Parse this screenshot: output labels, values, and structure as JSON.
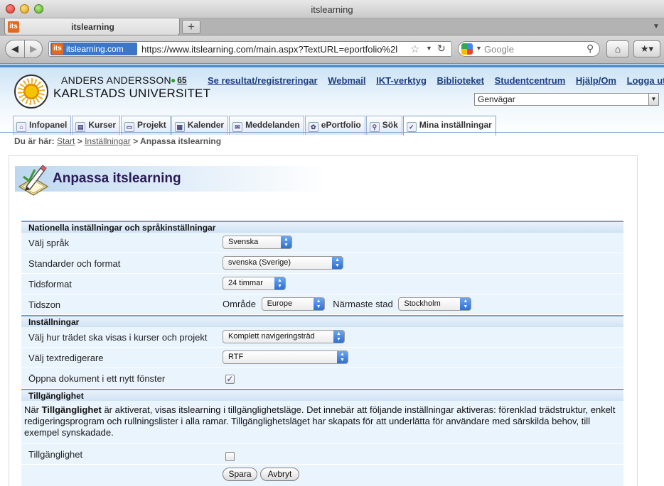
{
  "browser": {
    "window_title": "itslearning",
    "tab_label": "itslearning",
    "favicon_text": "its",
    "site_identity": "itslearning.com",
    "url": "https://www.itslearning.com/main.aspx?TextURL=eportfolio%2l",
    "search_placeholder": "Google"
  },
  "header": {
    "user_name": "ANDERS ANDERSSON",
    "online_count": "65",
    "university": "KARLSTADS UNIVERSITET",
    "links": [
      "Se resultat/registreringar",
      "Webmail",
      "IKT-verktyg",
      "Biblioteket",
      "Studentcentrum",
      "Hjälp/Om",
      "Logga ut"
    ],
    "shortcut_select": "Genvägar"
  },
  "mainnav": {
    "tabs": [
      {
        "label": "Infopanel",
        "icon": "home-icon"
      },
      {
        "label": "Kurser",
        "icon": "courses-icon"
      },
      {
        "label": "Projekt",
        "icon": "project-icon"
      },
      {
        "label": "Kalender",
        "icon": "calendar-icon"
      },
      {
        "label": "Meddelanden",
        "icon": "mail-icon"
      },
      {
        "label": "ePortfolio",
        "icon": "eportfolio-icon"
      },
      {
        "label": "Sök",
        "icon": "search-icon"
      },
      {
        "label": "Mina inställningar",
        "icon": "settings-icon",
        "active": true
      }
    ]
  },
  "breadcrumb": {
    "prefix": "Du är här:",
    "start": "Start",
    "sep": ">",
    "settings": "Inställningar",
    "current": "Anpassa itslearning"
  },
  "page": {
    "title": "Anpassa itslearning"
  },
  "sections": {
    "national": {
      "heading": "Nationella inställningar och språkinställningar",
      "language_label": "Välj språk",
      "language_value": "Svenska",
      "format_label": "Standarder och format",
      "format_value": "svenska (Sverige)",
      "time_label": "Tidsformat",
      "time_value": "24 timmar",
      "zone_label": "Tidszon",
      "area_label": "Område",
      "area_value": "Europe",
      "city_label": "Närmaste stad",
      "city_value": "Stockholm"
    },
    "settings": {
      "heading": "Inställningar",
      "tree_label": "Välj hur trädet ska visas i kurser och projekt",
      "tree_value": "Komplett navigeringsträd",
      "editor_label": "Välj textredigerare",
      "editor_value": "RTF",
      "newwindow_label": "Öppna dokument i ett nytt fönster",
      "newwindow_checked": true
    },
    "accessibility": {
      "heading": "Tillgänglighet",
      "desc_prefix": "När ",
      "desc_bold": "Tillgänglighet",
      "desc_rest": " är aktiverat, visas itslearning i tillgänglighetsläge. Det innebär att följande inställningar aktiveras: förenklad trädstruktur, enkelt redigeringsprogram och rullningslister i alla ramar. Tillgänglighetsläget har skapats för att underlätta för användare med särskilda behov, till exempel synskadade.",
      "toggle_label": "Tillgänglighet",
      "toggle_checked": false
    }
  },
  "buttons": {
    "save": "Spara",
    "cancel": "Avbryt"
  }
}
